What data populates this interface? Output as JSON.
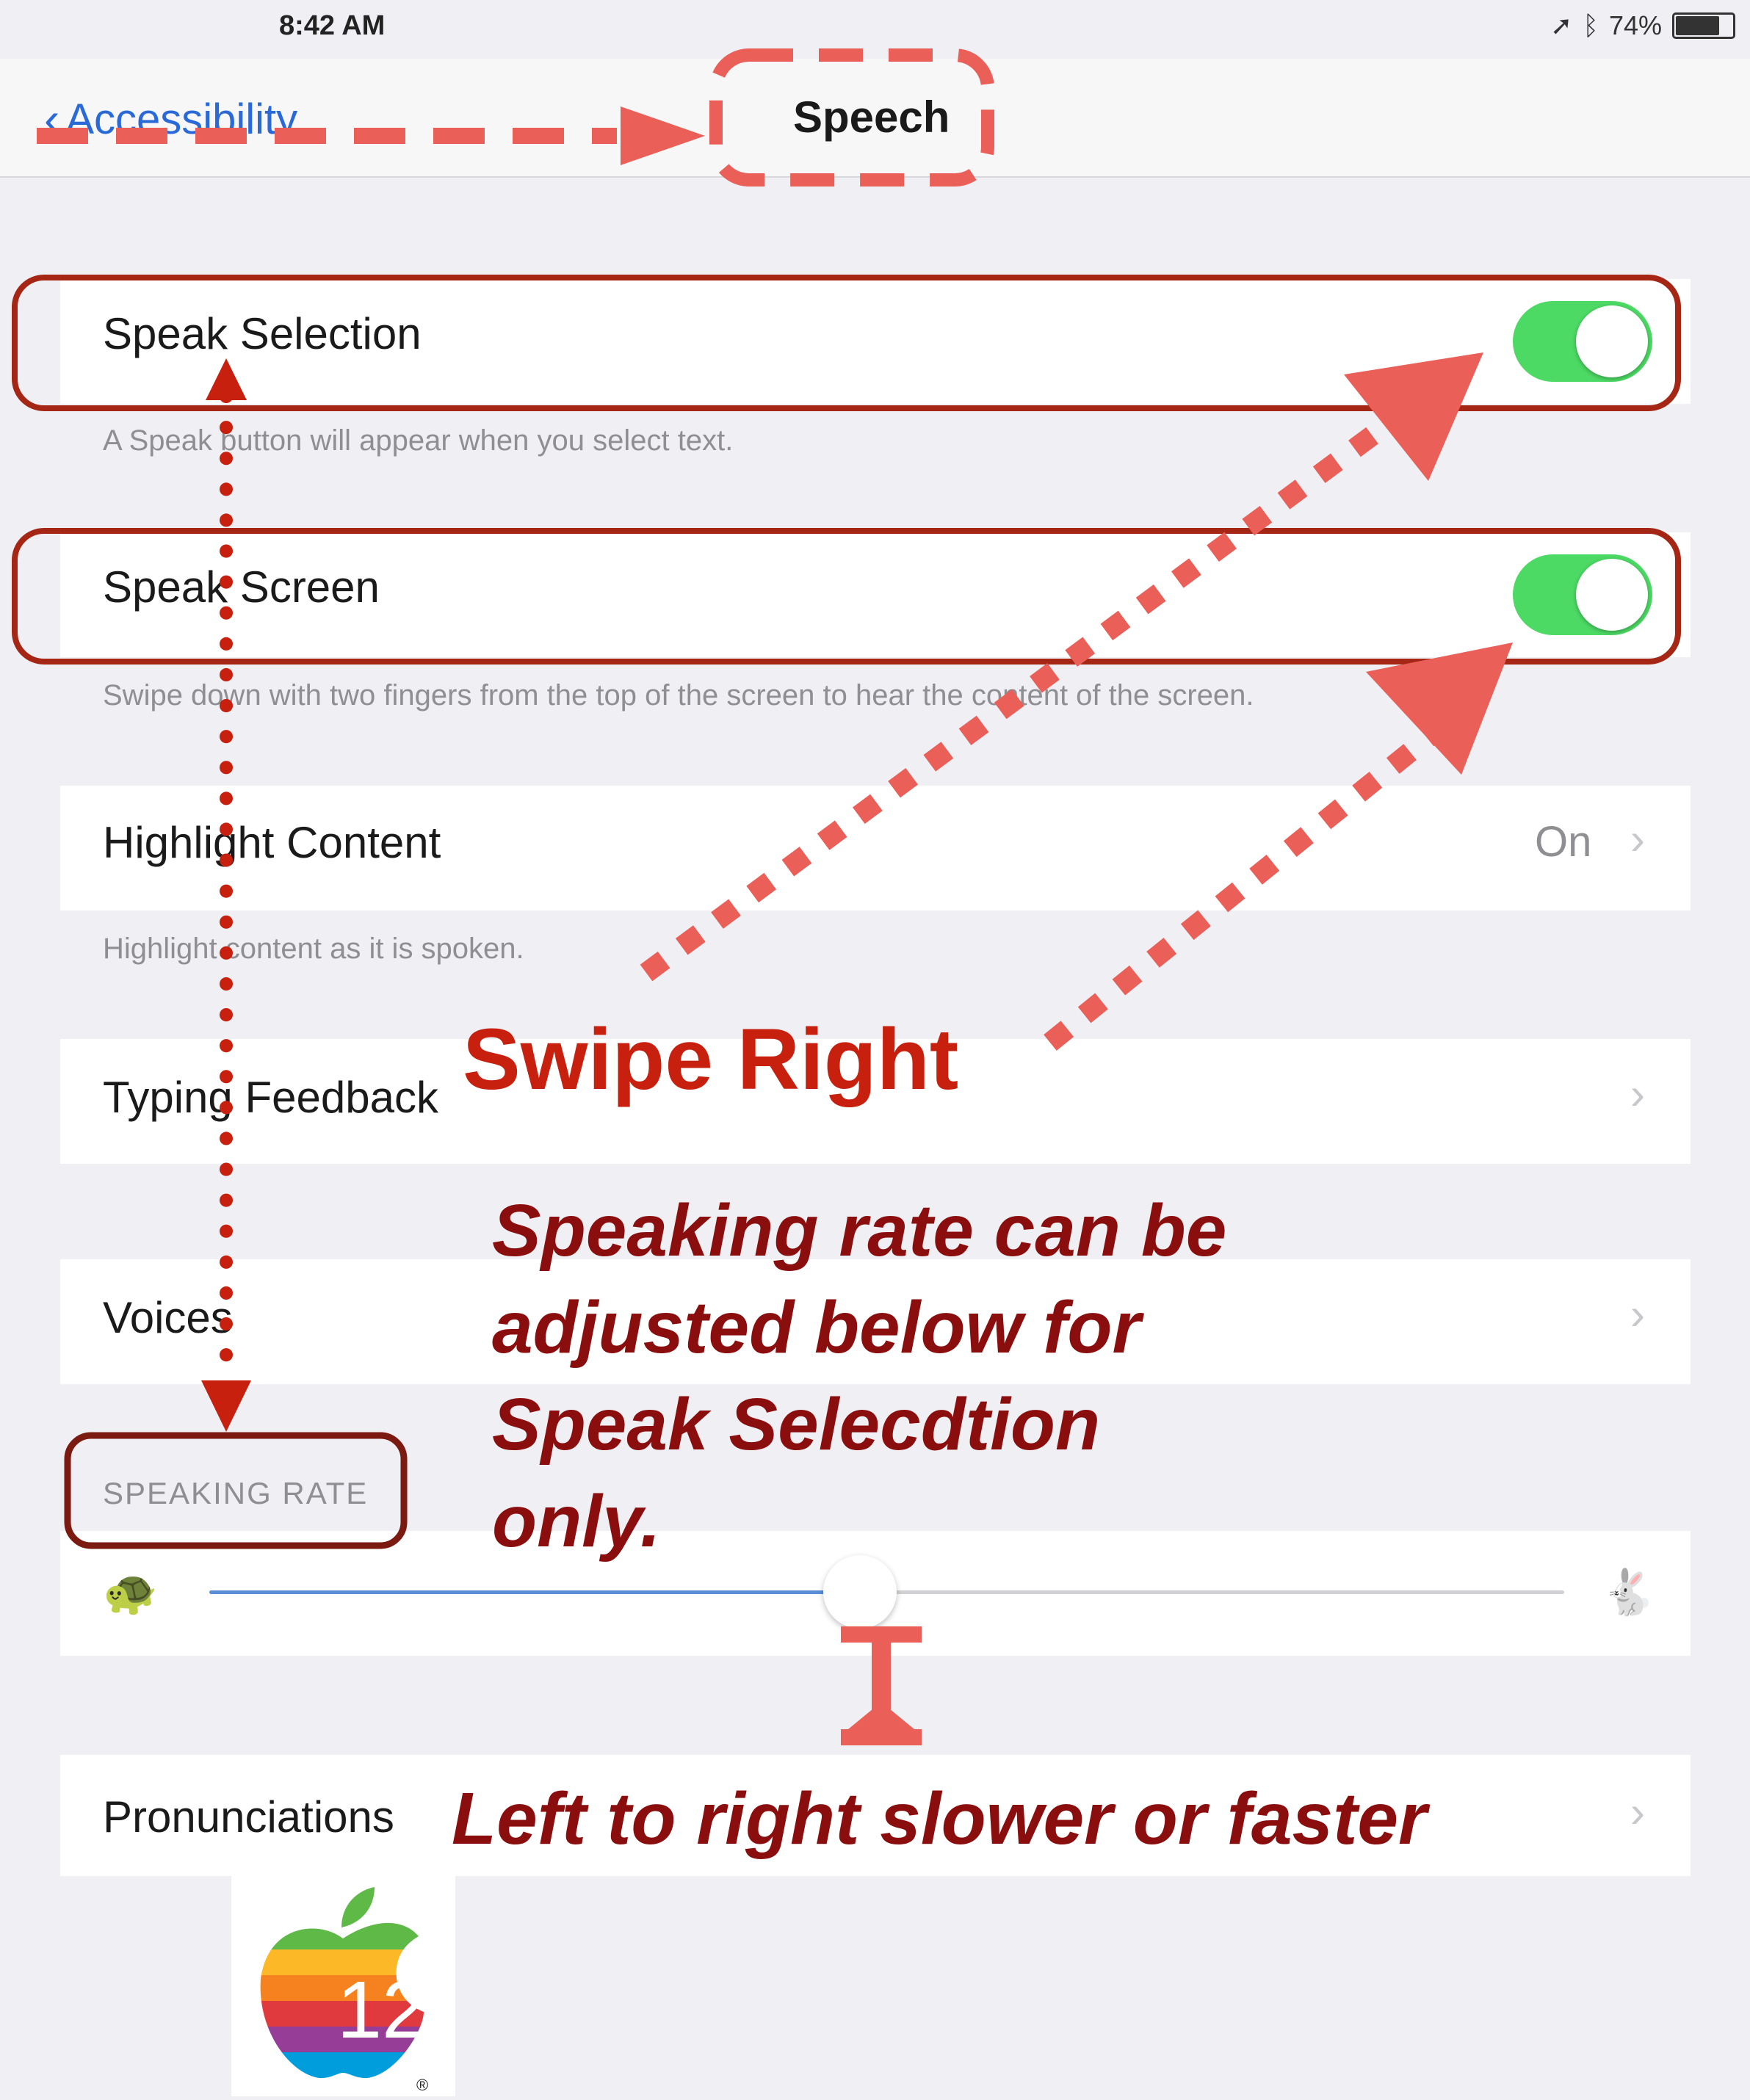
{
  "status_bar": {
    "time": "8:42 AM",
    "battery": "74%"
  },
  "nav": {
    "back_label": "Accessibility",
    "title": "Speech"
  },
  "rows": {
    "speak_selection": {
      "label": "Speak Selection",
      "footer": "A Speak button will appear when you select text.",
      "on": true
    },
    "speak_screen": {
      "label": "Speak Screen",
      "footer": "Swipe down with two fingers from the top of the screen to hear the content of the screen.",
      "on": true
    },
    "highlight_content": {
      "label": "Highlight Content",
      "value": "On",
      "footer": "Highlight content as it is spoken."
    },
    "typing_feedback": {
      "label": "Typing Feedback"
    },
    "voices": {
      "label": "Voices"
    },
    "pronunciations": {
      "label": "Pronunciations"
    }
  },
  "speaking_rate": {
    "header": "SPEAKING RATE",
    "level": 0.48
  },
  "icons": [
    "back-chevron-icon",
    "location-arrow-icon",
    "bluetooth-icon",
    "battery-icon",
    "turtle-icon",
    "hare-icon",
    "chevron-right-icon",
    "apple-rainbow-logo-icon"
  ],
  "annotations": {
    "swipe_right": "Swipe Right",
    "rate_note_line1": "Speaking rate can be",
    "rate_note_line2": "adjusted below for",
    "rate_note_line3": "Speak Selecdtion",
    "rate_note_line4": "only.",
    "slider_note": "Left to right slower or faster"
  },
  "logo": {
    "version": "12",
    "mark": "®"
  },
  "colors": {
    "toggle_on": "#4cd964",
    "link": "#2a6ad8",
    "annotation_red": "#c8200e",
    "annotation_dark_red": "#8b0e0e",
    "arrow_salmon": "#ea5f58",
    "box_border": "#a52614"
  }
}
